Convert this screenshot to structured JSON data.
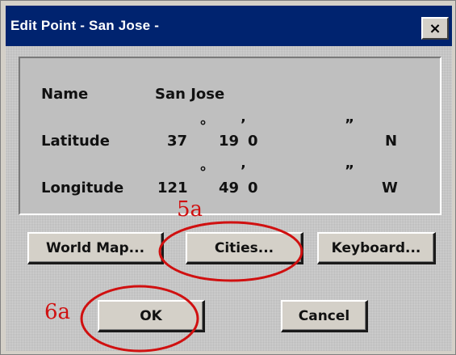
{
  "window": {
    "title": "Edit Point - San Jose -",
    "close_label": "×"
  },
  "point": {
    "name_label": "Name",
    "name_value": "San Jose",
    "latitude_label": "Latitude",
    "latitude_deg": "37",
    "latitude_min": "19",
    "latitude_sec": "0",
    "latitude_hemi": "N",
    "longitude_label": "Longitude",
    "longitude_deg": "121",
    "longitude_min": "49",
    "longitude_sec": "0",
    "longitude_hemi": "W",
    "degree_mark": "°",
    "minute_mark": "’",
    "second_mark": "”"
  },
  "buttons": {
    "world_map": "World Map...",
    "cities": "Cities...",
    "keyboard": "Keyboard...",
    "ok": "OK",
    "cancel": "Cancel"
  },
  "annotations": {
    "label_5a": "5a",
    "label_6a": "6a",
    "color": "#d01010"
  }
}
